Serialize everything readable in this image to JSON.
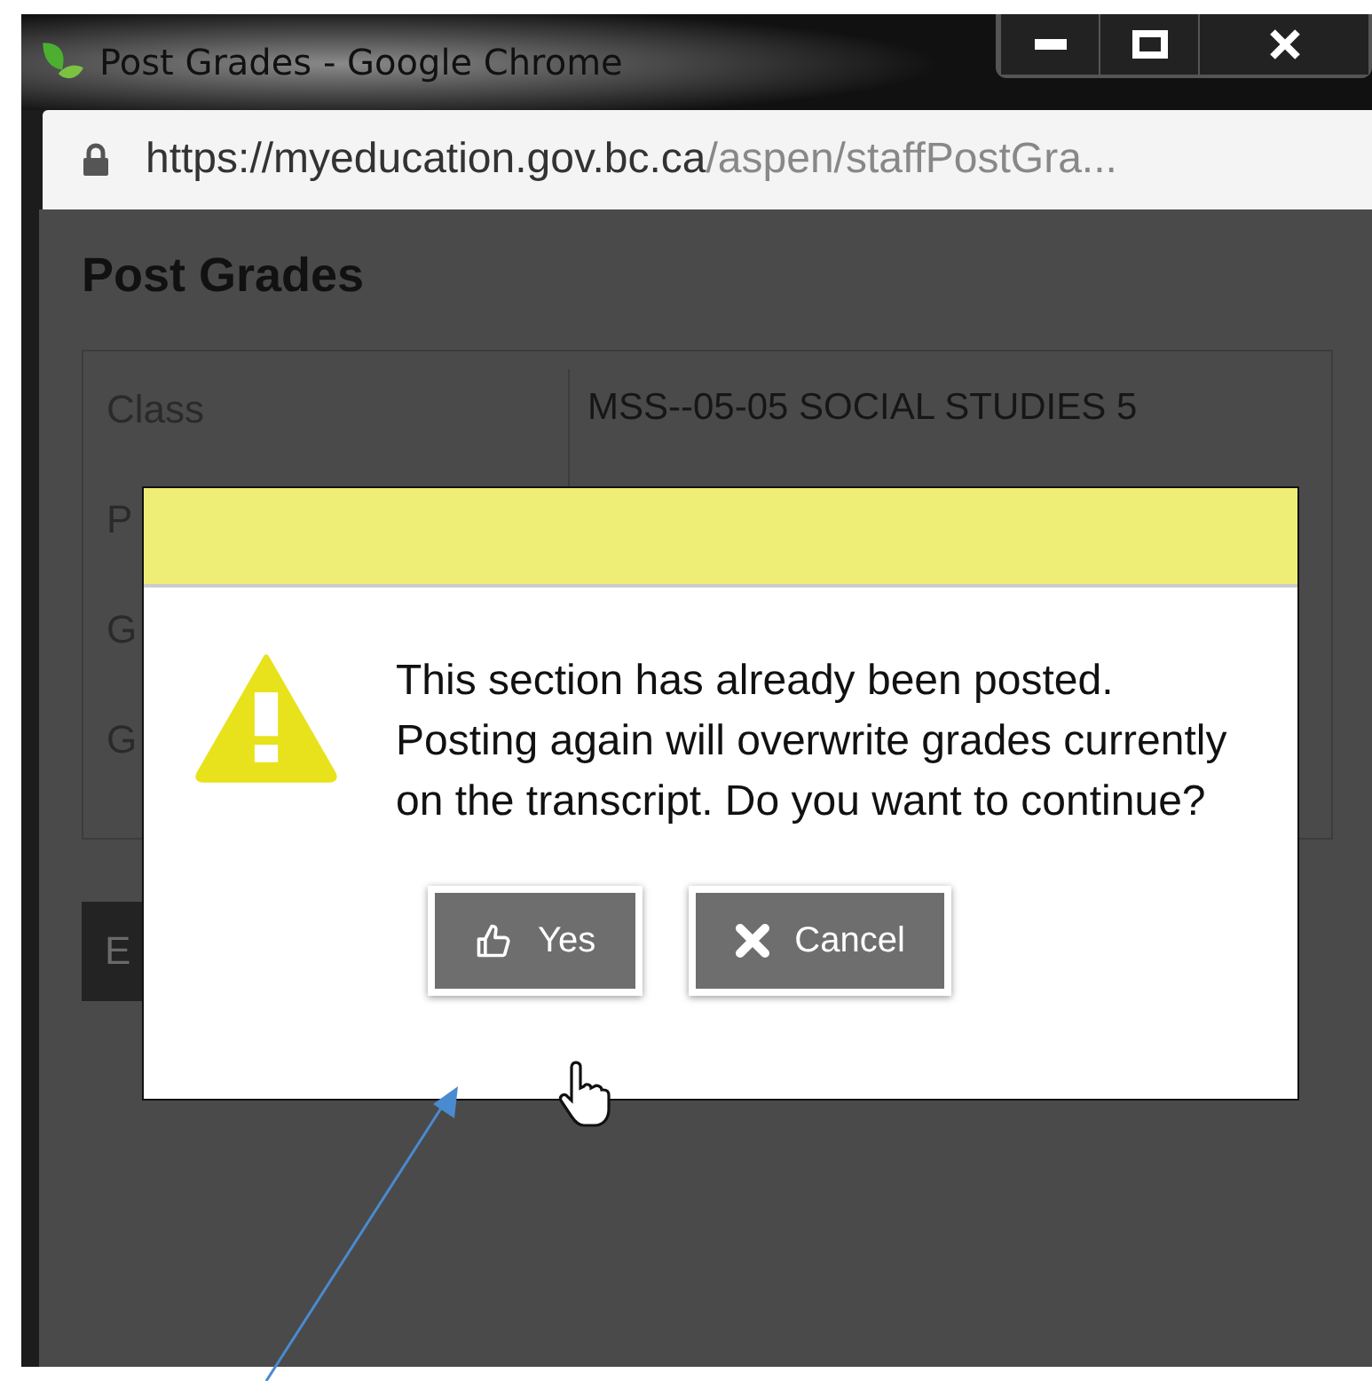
{
  "window": {
    "title": "Post Grades - Google Chrome"
  },
  "address_bar": {
    "host": "https://myeducation.gov.bc.ca",
    "path": "/aspen/staffPostGra..."
  },
  "page": {
    "heading": "Post Grades",
    "rows": [
      {
        "label": "Class",
        "value": "MSS--05-05  SOCIAL STUDIES 5"
      },
      {
        "label": "P"
      },
      {
        "label": "G"
      },
      {
        "label": "G"
      }
    ],
    "button": "E"
  },
  "dialog": {
    "message": "This section has already been posted. Posting again will overwrite grades currently on the transcript. Do you want to continue?",
    "buttons": [
      {
        "kind": "yes",
        "label": "Yes"
      },
      {
        "kind": "cancel",
        "label": "Cancel"
      }
    ]
  }
}
